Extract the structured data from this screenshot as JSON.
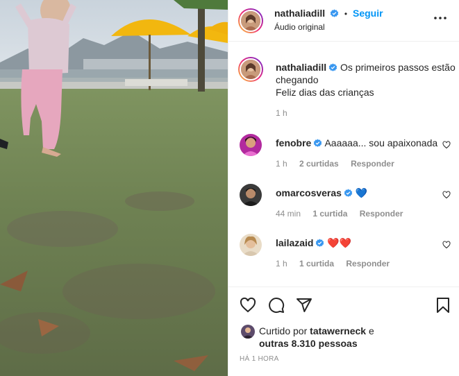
{
  "post": {
    "author": "nathaliadill",
    "follow_label": "Seguir",
    "separator": "•",
    "audio": "Áudio original",
    "more_label": "..."
  },
  "caption": {
    "username": "nathaliadill",
    "line1": "Os primeiros passos estão",
    "line2": "chegando",
    "line3": "Feliz dias das crianças",
    "time": "1 h"
  },
  "comments": [
    {
      "username": "fenobre",
      "text": "Aaaaaa... sou apaixonada",
      "time": "1 h",
      "likes": "2 curtidas",
      "reply": "Responder"
    },
    {
      "username": "omarcosveras",
      "text": "💙",
      "time": "44 min",
      "likes": "1 curtida",
      "reply": "Responder"
    },
    {
      "username": "lailazaid",
      "text": "❤️❤️",
      "time": "1 h",
      "likes": "1 curtida",
      "reply": "Responder"
    }
  ],
  "likes": {
    "prefix": "Curtido por",
    "by": "tatawerneck",
    "suffix": "e",
    "others": "outras 8.310 pessoas"
  },
  "timestamp": "HÁ 1 HORA",
  "colors": {
    "accent": "#0095f6",
    "verified": "#3897f0",
    "heart": "#ed4956",
    "blue_heart": "#3f8fe0"
  },
  "icons": [
    "heart-icon",
    "comment-icon",
    "share-icon",
    "bookmark-icon",
    "more-icon",
    "verified-icon"
  ]
}
